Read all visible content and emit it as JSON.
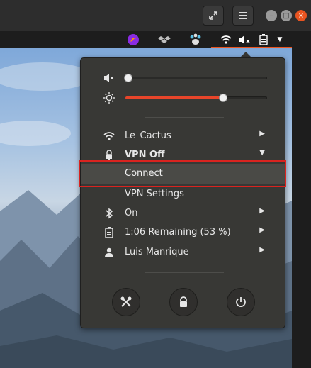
{
  "panel": {
    "icons": [
      "firefox-like-icon",
      "dropbox-icon",
      "paw-icon",
      "wifi-icon",
      "volume-muted-icon",
      "battery-icon",
      "dropdown-arrow-icon"
    ]
  },
  "menu": {
    "volume_level": 0.0,
    "brightness_level": 0.7,
    "wifi_label": "Le_Cactus",
    "vpn_label": "VPN Off",
    "vpn_connect_label": "Connect",
    "vpn_settings_label": "VPN Settings",
    "bluetooth_label": "On",
    "battery_label": "1:06 Remaining (53 %)",
    "user_label": "Luis Manrique"
  },
  "colors": {
    "accent": "#e95420",
    "slider_fill": "#e8452a",
    "highlight_border": "#d9231f"
  }
}
